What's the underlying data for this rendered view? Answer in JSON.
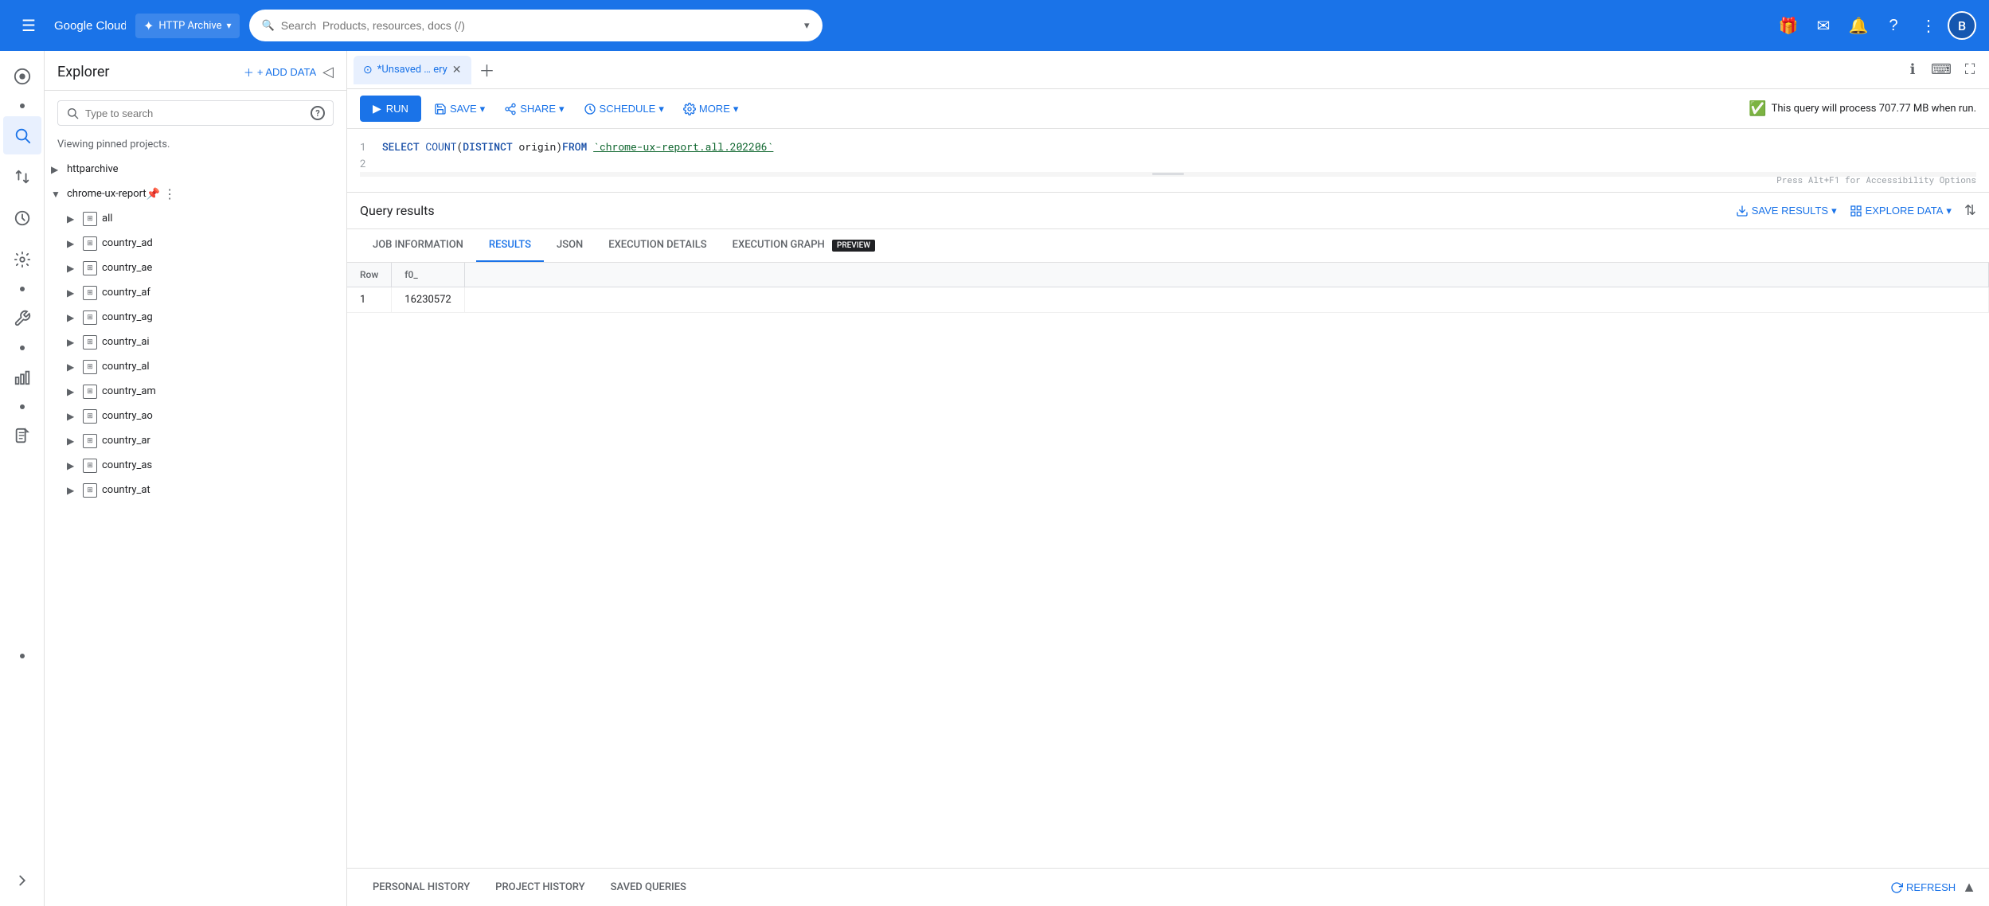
{
  "topNav": {
    "hamburger": "☰",
    "logoText": "Google Cloud",
    "projectName": "HTTP Archive",
    "searchPlaceholder": "Search  Products, resources, docs (/)",
    "avatarLetter": "B"
  },
  "explorer": {
    "title": "Explorer",
    "addDataLabel": "+ ADD DATA",
    "searchPlaceholder": "Type to search",
    "viewingText": "Viewing pinned projects.",
    "projects": [
      {
        "id": "httparchive",
        "name": "httparchive",
        "expanded": false,
        "indent": 0
      },
      {
        "id": "chrome-ux-report",
        "name": "chrome-ux-report",
        "expanded": true,
        "indent": 0
      },
      {
        "id": "all",
        "name": "all",
        "indent": 1
      },
      {
        "id": "country_ad",
        "name": "country_ad",
        "indent": 1
      },
      {
        "id": "country_ae",
        "name": "country_ae",
        "indent": 1
      },
      {
        "id": "country_af",
        "name": "country_af",
        "indent": 1
      },
      {
        "id": "country_ag",
        "name": "country_ag",
        "indent": 1
      },
      {
        "id": "country_ai",
        "name": "country_ai",
        "indent": 1
      },
      {
        "id": "country_al",
        "name": "country_al",
        "indent": 1
      },
      {
        "id": "country_am",
        "name": "country_am",
        "indent": 1
      },
      {
        "id": "country_ao",
        "name": "country_ao",
        "indent": 1
      },
      {
        "id": "country_ar",
        "name": "country_ar",
        "indent": 1
      },
      {
        "id": "country_as",
        "name": "country_as",
        "indent": 1
      },
      {
        "id": "country_at",
        "name": "country_at",
        "indent": 1
      }
    ]
  },
  "queryTab": {
    "label": "*Unsaved … ery",
    "icon": "⊙"
  },
  "toolbar": {
    "runLabel": "RUN",
    "saveLabel": "SAVE",
    "shareLabel": "SHARE",
    "scheduleLabel": "SCHEDULE",
    "moreLabel": "MORE",
    "queryInfo": "This query will process 707.77 MB when run."
  },
  "codeEditor": {
    "line1": "SELECT COUNT(DISTINCT origin) FROM `chrome-ux-report.all.202206`",
    "line1Number": "1",
    "line2Number": "2",
    "accessibilityHint": "Press Alt+F1 for Accessibility Options"
  },
  "results": {
    "title": "Query results",
    "saveResultsLabel": "SAVE RESULTS",
    "exploreDataLabel": "EXPLORE DATA",
    "tabs": [
      {
        "id": "job-information",
        "label": "JOB INFORMATION",
        "active": false
      },
      {
        "id": "results",
        "label": "RESULTS",
        "active": true
      },
      {
        "id": "json",
        "label": "JSON",
        "active": false
      },
      {
        "id": "execution-details",
        "label": "EXECUTION DETAILS",
        "active": false
      },
      {
        "id": "execution-graph",
        "label": "EXECUTION GRAPH",
        "active": false
      }
    ],
    "previewBadge": "PREVIEW",
    "tableColumns": [
      "Row",
      "f0_"
    ],
    "tableRows": [
      {
        "row": "1",
        "f0_": "16230572"
      }
    ]
  },
  "bottomBar": {
    "tabs": [
      "PERSONAL HISTORY",
      "PROJECT HISTORY",
      "SAVED QUERIES"
    ],
    "refreshLabel": "REFRESH"
  }
}
